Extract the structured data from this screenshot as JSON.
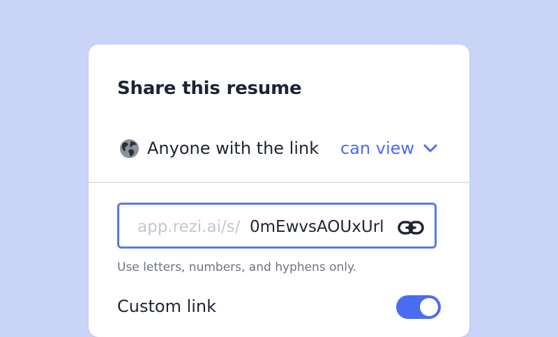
{
  "dialog": {
    "title": "Share this resume",
    "access": {
      "icon": "globe-icon",
      "label": "Anyone with the link",
      "permission": "can view"
    },
    "url_field": {
      "prefix": "app.rezi.ai/s/",
      "value": "0mEwvsAOUxUrl",
      "icon": "link-icon"
    },
    "helper_text": "Use letters, numbers, and hyphens only.",
    "custom_link": {
      "label": "Custom link",
      "enabled": true
    }
  },
  "colors": {
    "background": "#cad4f8",
    "accent": "#4a6cf0",
    "text": "#1d2433",
    "muted_text": "#6b7280",
    "placeholder": "#c4c7cf"
  }
}
